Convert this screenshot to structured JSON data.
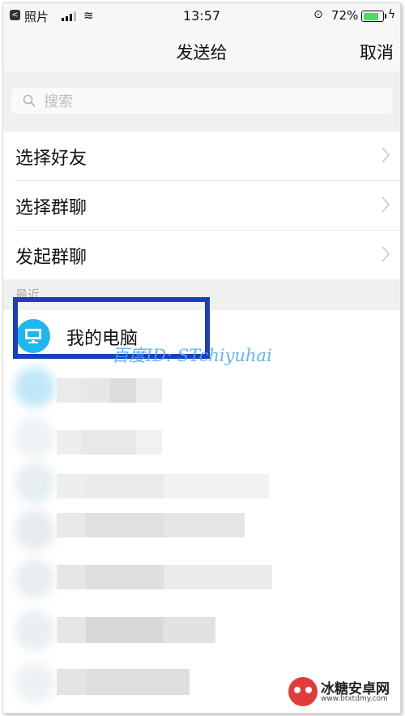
{
  "status_bar": {
    "app": "照片",
    "back_glyph": "<",
    "wifi_glyph": "≋",
    "time": "13:57",
    "lock_glyph": "⊙",
    "battery_pct": "72%",
    "charge_glyph": "ϟ"
  },
  "nav": {
    "title": "发送给",
    "cancel": "取消"
  },
  "search": {
    "placeholder": "搜索"
  },
  "menu": [
    {
      "label": "选择好友"
    },
    {
      "label": "选择群聊"
    },
    {
      "label": "发起群聊"
    }
  ],
  "recent": {
    "header": "最近",
    "items": [
      {
        "label": "我的电脑",
        "icon": "computer-icon"
      }
    ]
  },
  "watermark": {
    "text": "百度ID: STchiyuhai"
  },
  "logo": {
    "name": "冰糖安卓网",
    "url": "www.btxtdmy.com"
  },
  "colors": {
    "accent_blue": "#1fb7ee",
    "highlight_border": "#1a3ebd",
    "battery_green": "#4cd964"
  }
}
